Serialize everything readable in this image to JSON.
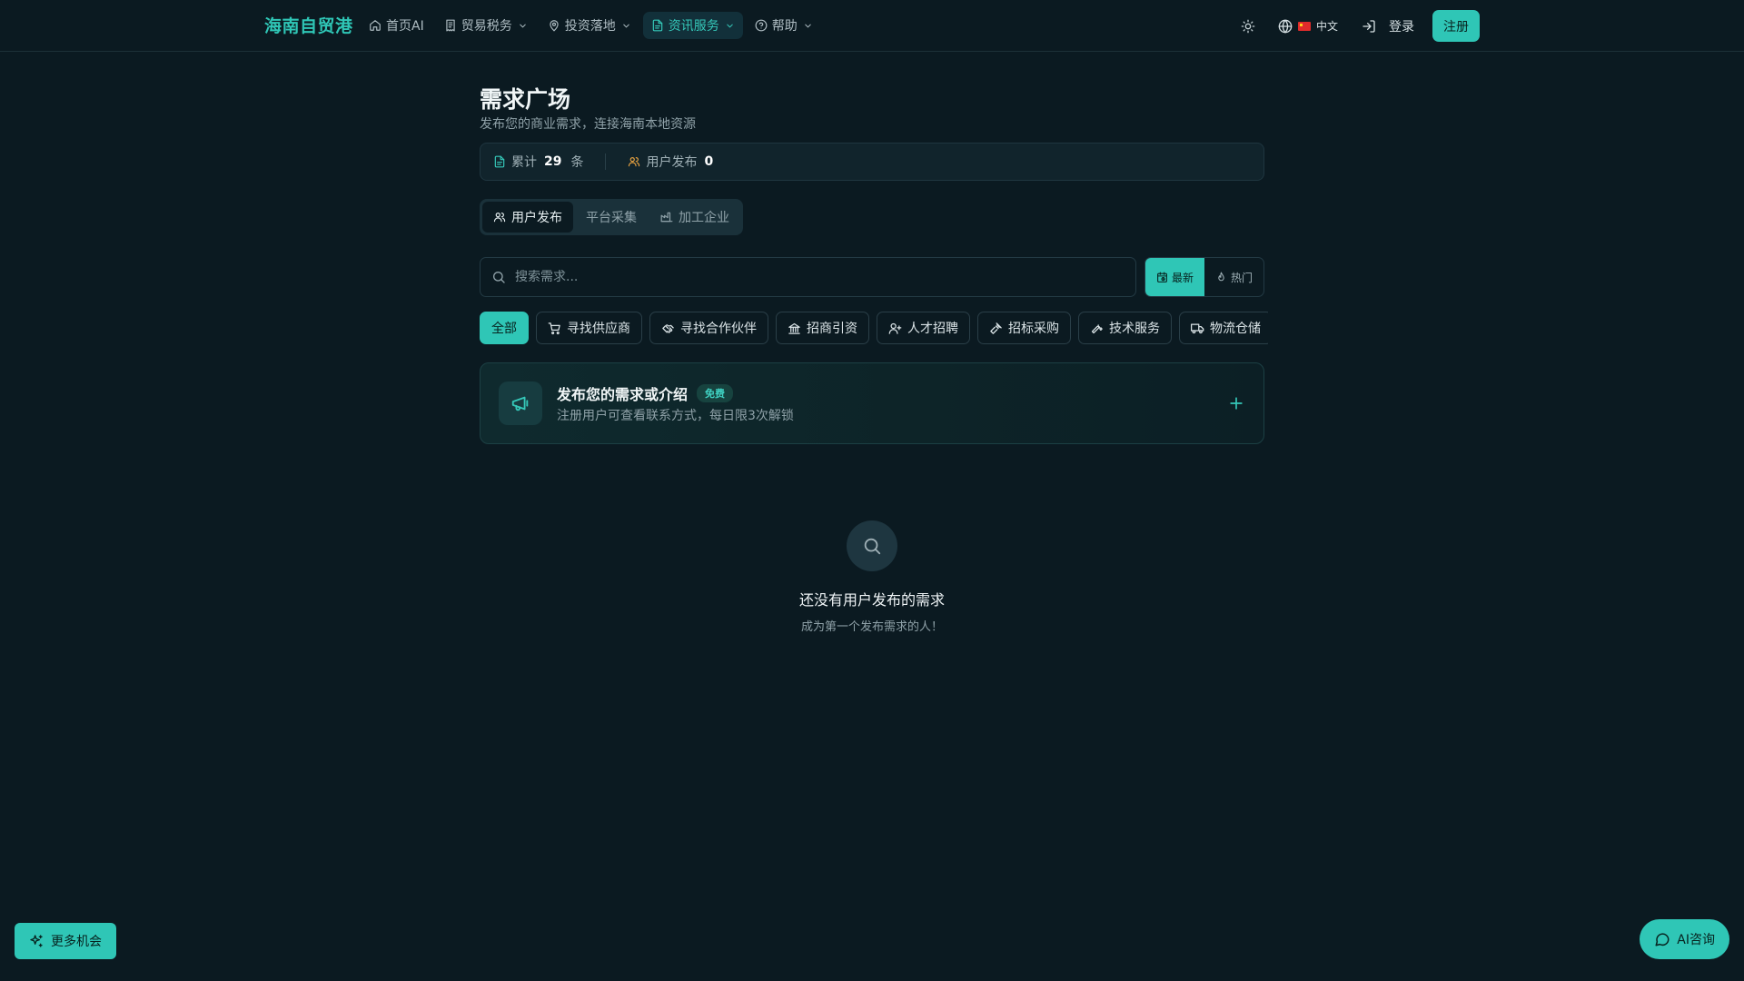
{
  "brand": {
    "logo": "海南自贸港",
    "accent": "#2fc6b6",
    "background": "#0b1a21"
  },
  "nav": {
    "items": [
      {
        "label": "首页AI",
        "icon": "home-icon"
      },
      {
        "label": "贸易税务",
        "icon": "receipt-icon"
      },
      {
        "label": "投资落地",
        "icon": "map-pin-icon"
      },
      {
        "label": "资讯服务",
        "icon": "document-icon"
      },
      {
        "label": "帮助",
        "icon": "help-circle-icon"
      }
    ],
    "language": "中文",
    "login": "登录",
    "register": "注册"
  },
  "page": {
    "title": "需求广场",
    "subtitle": "发布您的商业需求，连接海南本地资源"
  },
  "stats": {
    "total_label": "累计",
    "total_value": "29",
    "total_unit": "条",
    "user_label": "用户发布",
    "user_value": "0"
  },
  "tabs": [
    {
      "label": "用户发布",
      "icon": "users-icon"
    },
    {
      "label": "平台采集"
    },
    {
      "label": "加工企业",
      "icon": "factory-icon"
    }
  ],
  "search": {
    "placeholder": "搜索需求..."
  },
  "sort": {
    "latest": "最新",
    "hot": "热门"
  },
  "categories": [
    {
      "label": "全部"
    },
    {
      "label": "寻找供应商",
      "icon": "cart-icon"
    },
    {
      "label": "寻找合作伙伴",
      "icon": "handshake-icon"
    },
    {
      "label": "招商引资",
      "icon": "bank-icon"
    },
    {
      "label": "人才招聘",
      "icon": "user-plus-icon"
    },
    {
      "label": "招标采购",
      "icon": "gavel-icon"
    },
    {
      "label": "技术服务",
      "icon": "wrench-icon"
    },
    {
      "label": "物流仓储",
      "icon": "truck-icon"
    }
  ],
  "publish": {
    "title": "发布您的需求或介绍",
    "badge": "免费",
    "subtitle": "注册用户可查看联系方式，每日限3次解锁"
  },
  "empty": {
    "title": "还没有用户发布的需求",
    "subtitle": "成为第一个发布需求的人！"
  },
  "floating": {
    "more": "更多机会",
    "ai": "AI咨询"
  }
}
